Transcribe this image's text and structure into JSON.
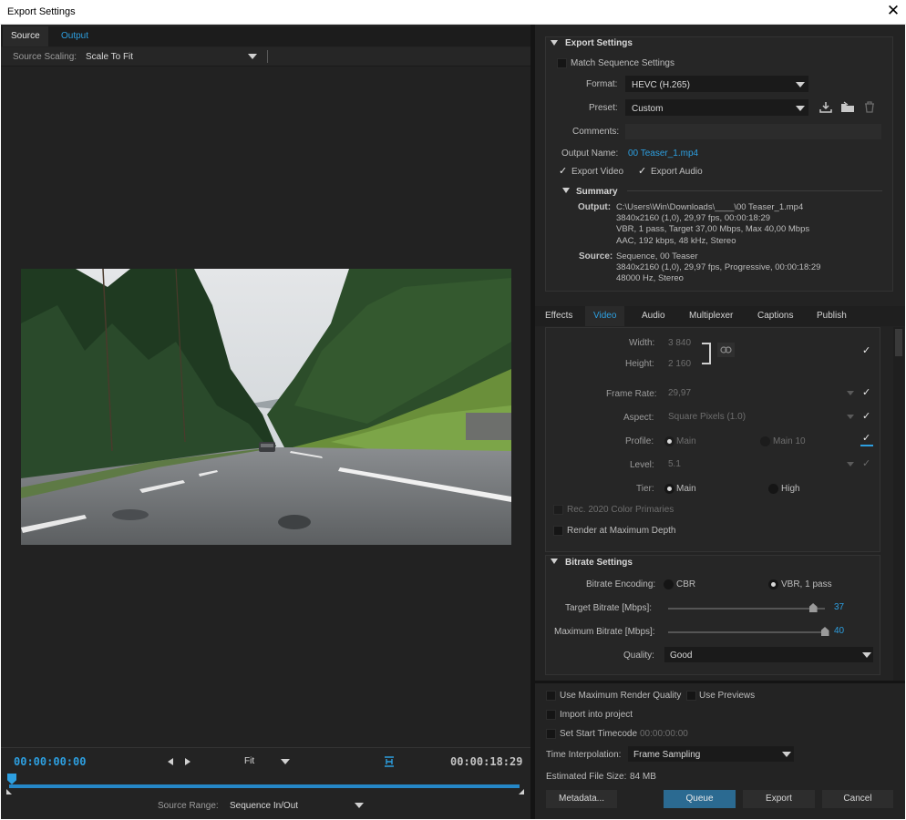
{
  "window": {
    "title": "Export Settings",
    "close": "✕"
  },
  "left": {
    "tabs": [
      {
        "label": "Source"
      },
      {
        "label": "Output"
      }
    ],
    "source_scaling_label": "Source Scaling:",
    "source_scaling_value": "Scale To Fit",
    "timecode_start": "00:00:00:00",
    "timecode_end": "00:00:18:29",
    "zoom_value": "Fit",
    "source_range_label": "Source Range:",
    "source_range_value": "Sequence In/Out"
  },
  "export_settings": {
    "header": "Export Settings",
    "match_sequence": "Match Sequence Settings",
    "format_label": "Format:",
    "format_value": "HEVC (H.265)",
    "preset_label": "Preset:",
    "preset_value": "Custom",
    "comments_label": "Comments:",
    "output_name_label": "Output Name:",
    "output_name_value": "00 Teaser_1.mp4",
    "export_video": "Export Video",
    "export_audio": "Export Audio",
    "summary_header": "Summary",
    "summary_output_label": "Output:",
    "summary_output_lines": [
      "C:\\Users\\Win\\Downloads\\____\\00 Teaser_1.mp4",
      "3840x2160 (1,0), 29,97 fps, 00:00:18:29",
      "VBR, 1 pass, Target 37,00 Mbps, Max 40,00 Mbps",
      "AAC, 192 kbps, 48 kHz, Stereo"
    ],
    "summary_source_label": "Source:",
    "summary_source_lines": [
      "Sequence, 00 Teaser",
      "3840x2160 (1,0), 29,97 fps, Progressive, 00:00:18:29",
      "48000 Hz, Stereo"
    ]
  },
  "settings_tabs": [
    "Effects",
    "Video",
    "Audio",
    "Multiplexer",
    "Captions",
    "Publish"
  ],
  "video": {
    "width_label": "Width:",
    "width_value": "3 840",
    "height_label": "Height:",
    "height_value": "2 160",
    "frame_rate_label": "Frame Rate:",
    "frame_rate_value": "29,97",
    "aspect_label": "Aspect:",
    "aspect_value": "Square Pixels (1.0)",
    "profile_label": "Profile:",
    "profile_main": "Main",
    "profile_main10": "Main 10",
    "level_label": "Level:",
    "level_value": "5.1",
    "tier_label": "Tier:",
    "tier_main": "Main",
    "tier_high": "High",
    "rec2020": "Rec. 2020 Color Primaries",
    "render_max_depth": "Render at Maximum Depth"
  },
  "bitrate": {
    "header": "Bitrate Settings",
    "encoding_label": "Bitrate Encoding:",
    "cbr": "CBR",
    "vbr": "VBR, 1 pass",
    "target_label": "Target Bitrate [Mbps]:",
    "target_value": "37",
    "target_fraction": 0.925,
    "max_label": "Maximum Bitrate [Mbps]:",
    "max_value": "40",
    "max_fraction": 1.0,
    "quality_label": "Quality:",
    "quality_value": "Good"
  },
  "bottom": {
    "use_max_render": "Use Maximum Render Quality",
    "use_previews": "Use Previews",
    "import_project": "Import into project",
    "set_start_tc": "Set Start Timecode",
    "start_tc_value": "00:00:00:00",
    "time_interp_label": "Time Interpolation:",
    "time_interp_value": "Frame Sampling",
    "file_size_label": "Estimated File Size:",
    "file_size_value": "84 MB",
    "metadata": "Metadata...",
    "queue": "Queue",
    "export": "Export",
    "cancel": "Cancel"
  }
}
